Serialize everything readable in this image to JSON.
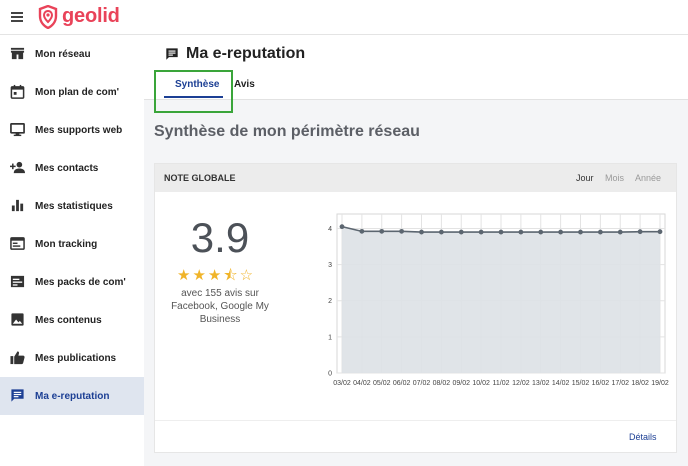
{
  "app": {
    "brand": "geolid"
  },
  "sidebar": {
    "items": [
      {
        "label": "Mon réseau",
        "icon": "store-icon",
        "active": false
      },
      {
        "label": "Mon plan de com'",
        "icon": "calendar-icon",
        "active": false
      },
      {
        "label": "Mes supports web",
        "icon": "monitor-icon",
        "active": false
      },
      {
        "label": "Mes contacts",
        "icon": "add-person-icon",
        "active": false
      },
      {
        "label": "Mes statistiques",
        "icon": "bar-chart-icon",
        "active": false
      },
      {
        "label": "Mon tracking",
        "icon": "web-window-icon",
        "active": false
      },
      {
        "label": "Mes packs de com'",
        "icon": "package-icon",
        "active": false
      },
      {
        "label": "Mes contenus",
        "icon": "image-icon",
        "active": false
      },
      {
        "label": "Mes publications",
        "icon": "thumbs-up-icon",
        "active": false
      },
      {
        "label": "Ma e-reputation",
        "icon": "chat-icon",
        "active": true
      }
    ]
  },
  "page": {
    "title": "Ma e-reputation",
    "tabs": [
      {
        "label": "Synthèse",
        "active": true
      },
      {
        "label": "Avis",
        "active": false
      }
    ],
    "section_title": "Synthèse de mon périmètre réseau"
  },
  "card": {
    "title": "NOTE GLOBALE",
    "periods": [
      {
        "label": "Jour",
        "active": true
      },
      {
        "label": "Mois",
        "active": false
      },
      {
        "label": "Année",
        "active": false
      }
    ],
    "score": "3.9",
    "rating": 3.5,
    "rating_max": 5,
    "subtitle": "avec 155 avis sur Facebook, Google My Business",
    "details_label": "Détails"
  },
  "colors": {
    "brand": "#e94359",
    "accent": "#1c3f94",
    "star": "#f0b429",
    "area_fill": "#dde1e6",
    "line": "#5c6670"
  },
  "chart_data": {
    "type": "area",
    "x": [
      "03/02",
      "04/02",
      "05/02",
      "06/02",
      "07/02",
      "08/02",
      "09/02",
      "10/02",
      "11/02",
      "12/02",
      "13/02",
      "14/02",
      "15/02",
      "16/02",
      "17/02",
      "18/02",
      "19/02"
    ],
    "series": [
      {
        "values": [
          4.05,
          3.92,
          3.92,
          3.92,
          3.9,
          3.9,
          3.9,
          3.9,
          3.9,
          3.9,
          3.9,
          3.9,
          3.9,
          3.9,
          3.9,
          3.91,
          3.91
        ]
      }
    ],
    "ylim": [
      0,
      4.4
    ],
    "yticks": [
      "0",
      "1",
      "2",
      "3",
      "4"
    ],
    "grid": true,
    "xlabel": "",
    "ylabel": ""
  }
}
